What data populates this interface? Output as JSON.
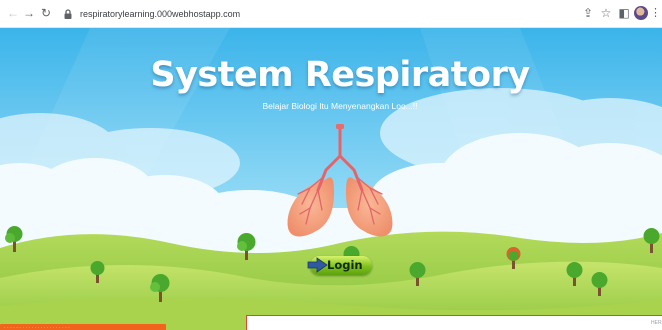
{
  "browser": {
    "url": "respiratorylearning.000webhostapp.com",
    "icons": {
      "back": "back-arrow-icon",
      "forward": "forward-arrow-icon",
      "reload": "reload-icon",
      "lock": "lock-icon",
      "share": "share-icon",
      "bookmark": "star-icon",
      "side_panel": "side-panel-icon",
      "profile": "avatar",
      "menu": "kebab-menu-icon"
    },
    "glyphs": {
      "back": "←",
      "forward": "→",
      "reload": "↻",
      "share": "⇪",
      "bookmark": "☆",
      "side_panel": "◧",
      "menu": "⋮"
    }
  },
  "page": {
    "title": "System Respiratory",
    "subtitle": "Belajar Biologi Itu Menyenangkan Loo...!!",
    "login_label": "Login",
    "corner_tag": "HERS",
    "banner_text": "· · · · · · · · · · · · · · · · · · · · · ·"
  },
  "colors": {
    "sky": "#5fc4ef",
    "hills": "#8cc63f",
    "lungs": "#f4a07e",
    "trachea": "#e96b6b",
    "login_button": "#7ec21c",
    "banner": "#f0641e",
    "panel_border": "#d94a3a"
  }
}
